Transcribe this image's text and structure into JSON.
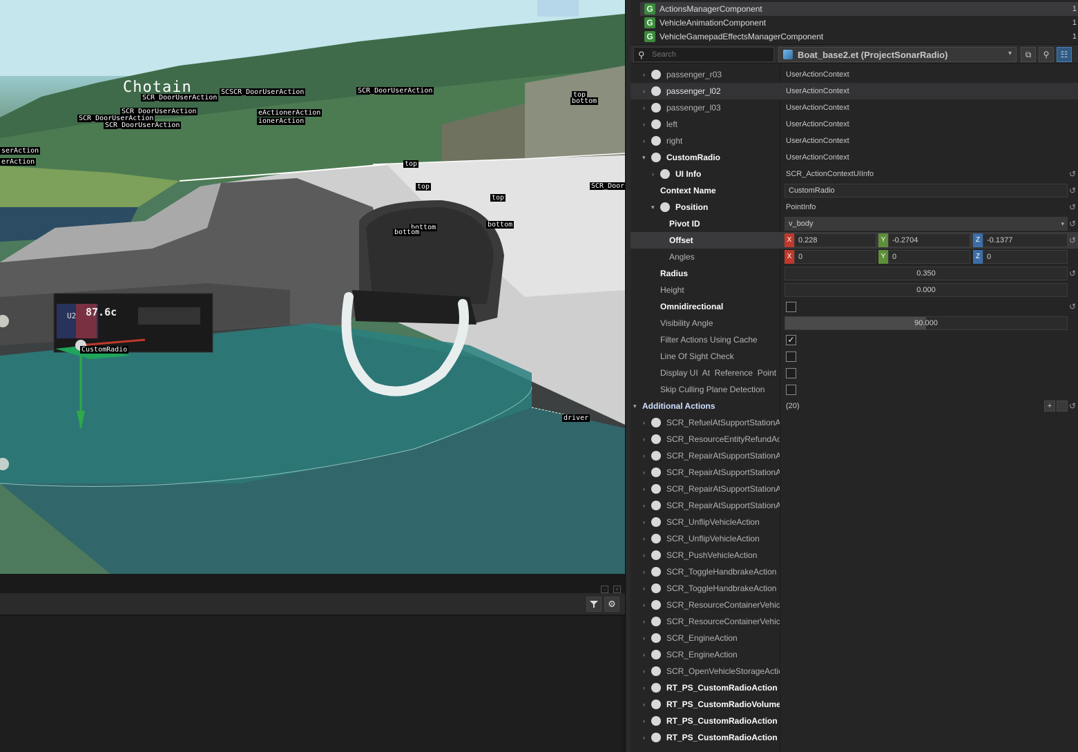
{
  "viewport": {
    "title_text": "Chotain",
    "labels": [
      "SCR_DoorUserAction",
      "SCSCR_DoorUserAction",
      "SCR_DoorUserAction",
      "SCR_DoorUserAction",
      "SCR_DoorUserAction",
      "SCR_DoorUserAction",
      "erAction",
      "serAction",
      "top",
      "bottom",
      "top",
      "top",
      "SCR_Door",
      "top",
      "bottom",
      "bottom",
      "bottom",
      "CustomRadio",
      "driver",
      "eActionerAction",
      "ionerAction"
    ],
    "radio_display": "87.6c",
    "radio_channel": "U2"
  },
  "log": {
    "filter_icon": "filter-icon",
    "settings_icon": "gear-icon"
  },
  "components": [
    {
      "name": "ActionsManagerComponent",
      "count": "1"
    },
    {
      "name": "VehicleAnimationComponent",
      "count": "1"
    },
    {
      "name": "VehicleGamepadEffectsManagerComponent",
      "count": "1"
    }
  ],
  "search": {
    "placeholder": "Search"
  },
  "entity": {
    "name": "Boat_base2.et (ProjectSonarRadio)"
  },
  "properties": {
    "passenger_r03": {
      "name": "passenger_r03",
      "value": "UserActionContext"
    },
    "passenger_l02": {
      "name": "passenger_l02",
      "value": "UserActionContext"
    },
    "passenger_l03": {
      "name": "passenger_l03",
      "value": "UserActionContext"
    },
    "left": {
      "name": "left",
      "value": "UserActionContext"
    },
    "right": {
      "name": "right",
      "value": "UserActionContext"
    },
    "customradio": {
      "name": "CustomRadio",
      "value": "UserActionContext"
    },
    "uiinfo": {
      "name": "UI Info",
      "value": "SCR_ActionContextUIInfo"
    },
    "contextname": {
      "name": "Context Name",
      "value": "CustomRadio"
    },
    "position": {
      "name": "Position",
      "value": "PointInfo"
    },
    "pivotid": {
      "name": "Pivot ID",
      "value": "v_body"
    },
    "offset": {
      "name": "Offset",
      "x": "0.228",
      "y": "-0.2704",
      "z": "-0.1377"
    },
    "angles": {
      "name": "Angles",
      "x": "0",
      "y": "0",
      "z": "0"
    },
    "radius": {
      "name": "Radius",
      "value": "0.350"
    },
    "height": {
      "name": "Height",
      "value": "0.000"
    },
    "omni": {
      "name": "Omnidirectional"
    },
    "visangle": {
      "name": "Visibility Angle",
      "value": "90.000",
      "fill": 0.5
    },
    "filtercache": {
      "name": "Filter Actions Using Cache"
    },
    "lineofsight": {
      "name": "Line Of Sight Check"
    },
    "displayui": {
      "name": "Display UI  At  Reference  Point"
    },
    "skipculling": {
      "name": "Skip Culling Plane Detection"
    },
    "additional": {
      "name": "Additional Actions",
      "value": "(20)"
    }
  },
  "axes": {
    "x": "X",
    "y": "Y",
    "z": "Z"
  },
  "actions": [
    "SCR_RefuelAtSupportStationAc",
    "SCR_ResourceEntityRefundActi",
    "SCR_RepairAtSupportStationAc",
    "SCR_RepairAtSupportStationAc",
    "SCR_RepairAtSupportStationAc",
    "SCR_RepairAtSupportStationAc",
    "SCR_UnflipVehicleAction",
    "SCR_UnflipVehicleAction",
    "SCR_PushVehicleAction",
    "SCR_ToggleHandbrakeAction",
    "SCR_ToggleHandbrakeAction",
    "SCR_ResourceContainerVehicle",
    "SCR_ResourceContainerVehicle",
    "SCR_EngineAction",
    "SCR_EngineAction",
    "SCR_OpenVehicleStorageAction",
    "RT_PS_CustomRadioAction",
    "RT_PS_CustomRadioVolumeAc",
    "RT_PS_CustomRadioAction",
    "RT_PS_CustomRadioAction"
  ],
  "symbols": {
    "check": "✓",
    "reset": "↺",
    "expanded": "▾",
    "collapsed": "›",
    "plus": "+",
    "dropdown": "▾"
  }
}
